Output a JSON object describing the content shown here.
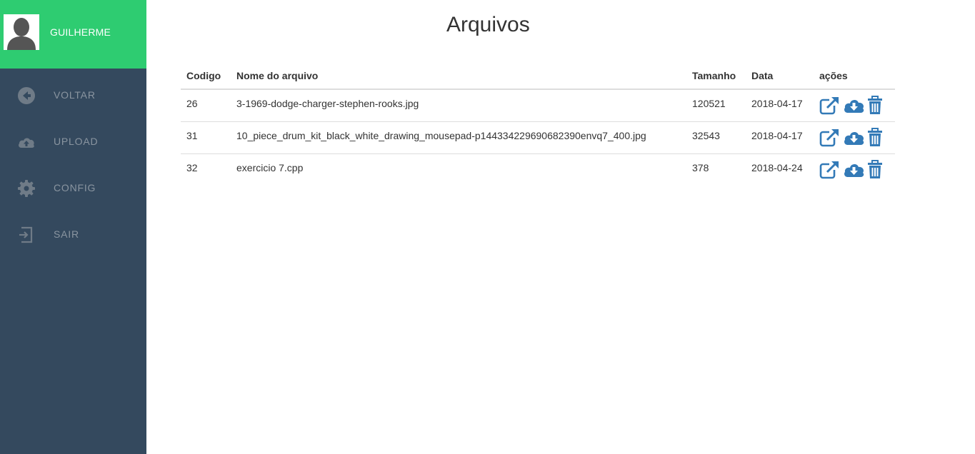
{
  "user": {
    "name": "GUILHERME"
  },
  "nav": [
    {
      "label": "VOLTAR",
      "icon": "arrow-left-circle-icon"
    },
    {
      "label": "UPLOAD",
      "icon": "cloud-upload-icon"
    },
    {
      "label": "CONFIG",
      "icon": "gear-icon"
    },
    {
      "label": "SAIR",
      "icon": "sign-in-icon"
    }
  ],
  "main": {
    "title": "Arquivos"
  },
  "table": {
    "headers": [
      "Codigo",
      "Nome do arquivo",
      "Tamanho",
      "Data",
      "ações"
    ],
    "rows": [
      {
        "codigo": "26",
        "nome": "3-1969-dodge-charger-stephen-rooks.jpg",
        "tamanho": "120521",
        "data": "2018-04-17"
      },
      {
        "codigo": "31",
        "nome": "10_piece_drum_kit_black_white_drawing_mousepad-p144334229690682390envq7_400.jpg",
        "tamanho": "32543",
        "data": "2018-04-17"
      },
      {
        "codigo": "32",
        "nome": "exercicio 7.cpp",
        "tamanho": "378",
        "data": "2018-04-24"
      }
    ]
  },
  "colors": {
    "sidebar": "#34495e",
    "accent": "#2ecc71",
    "action": "#337ab7"
  }
}
